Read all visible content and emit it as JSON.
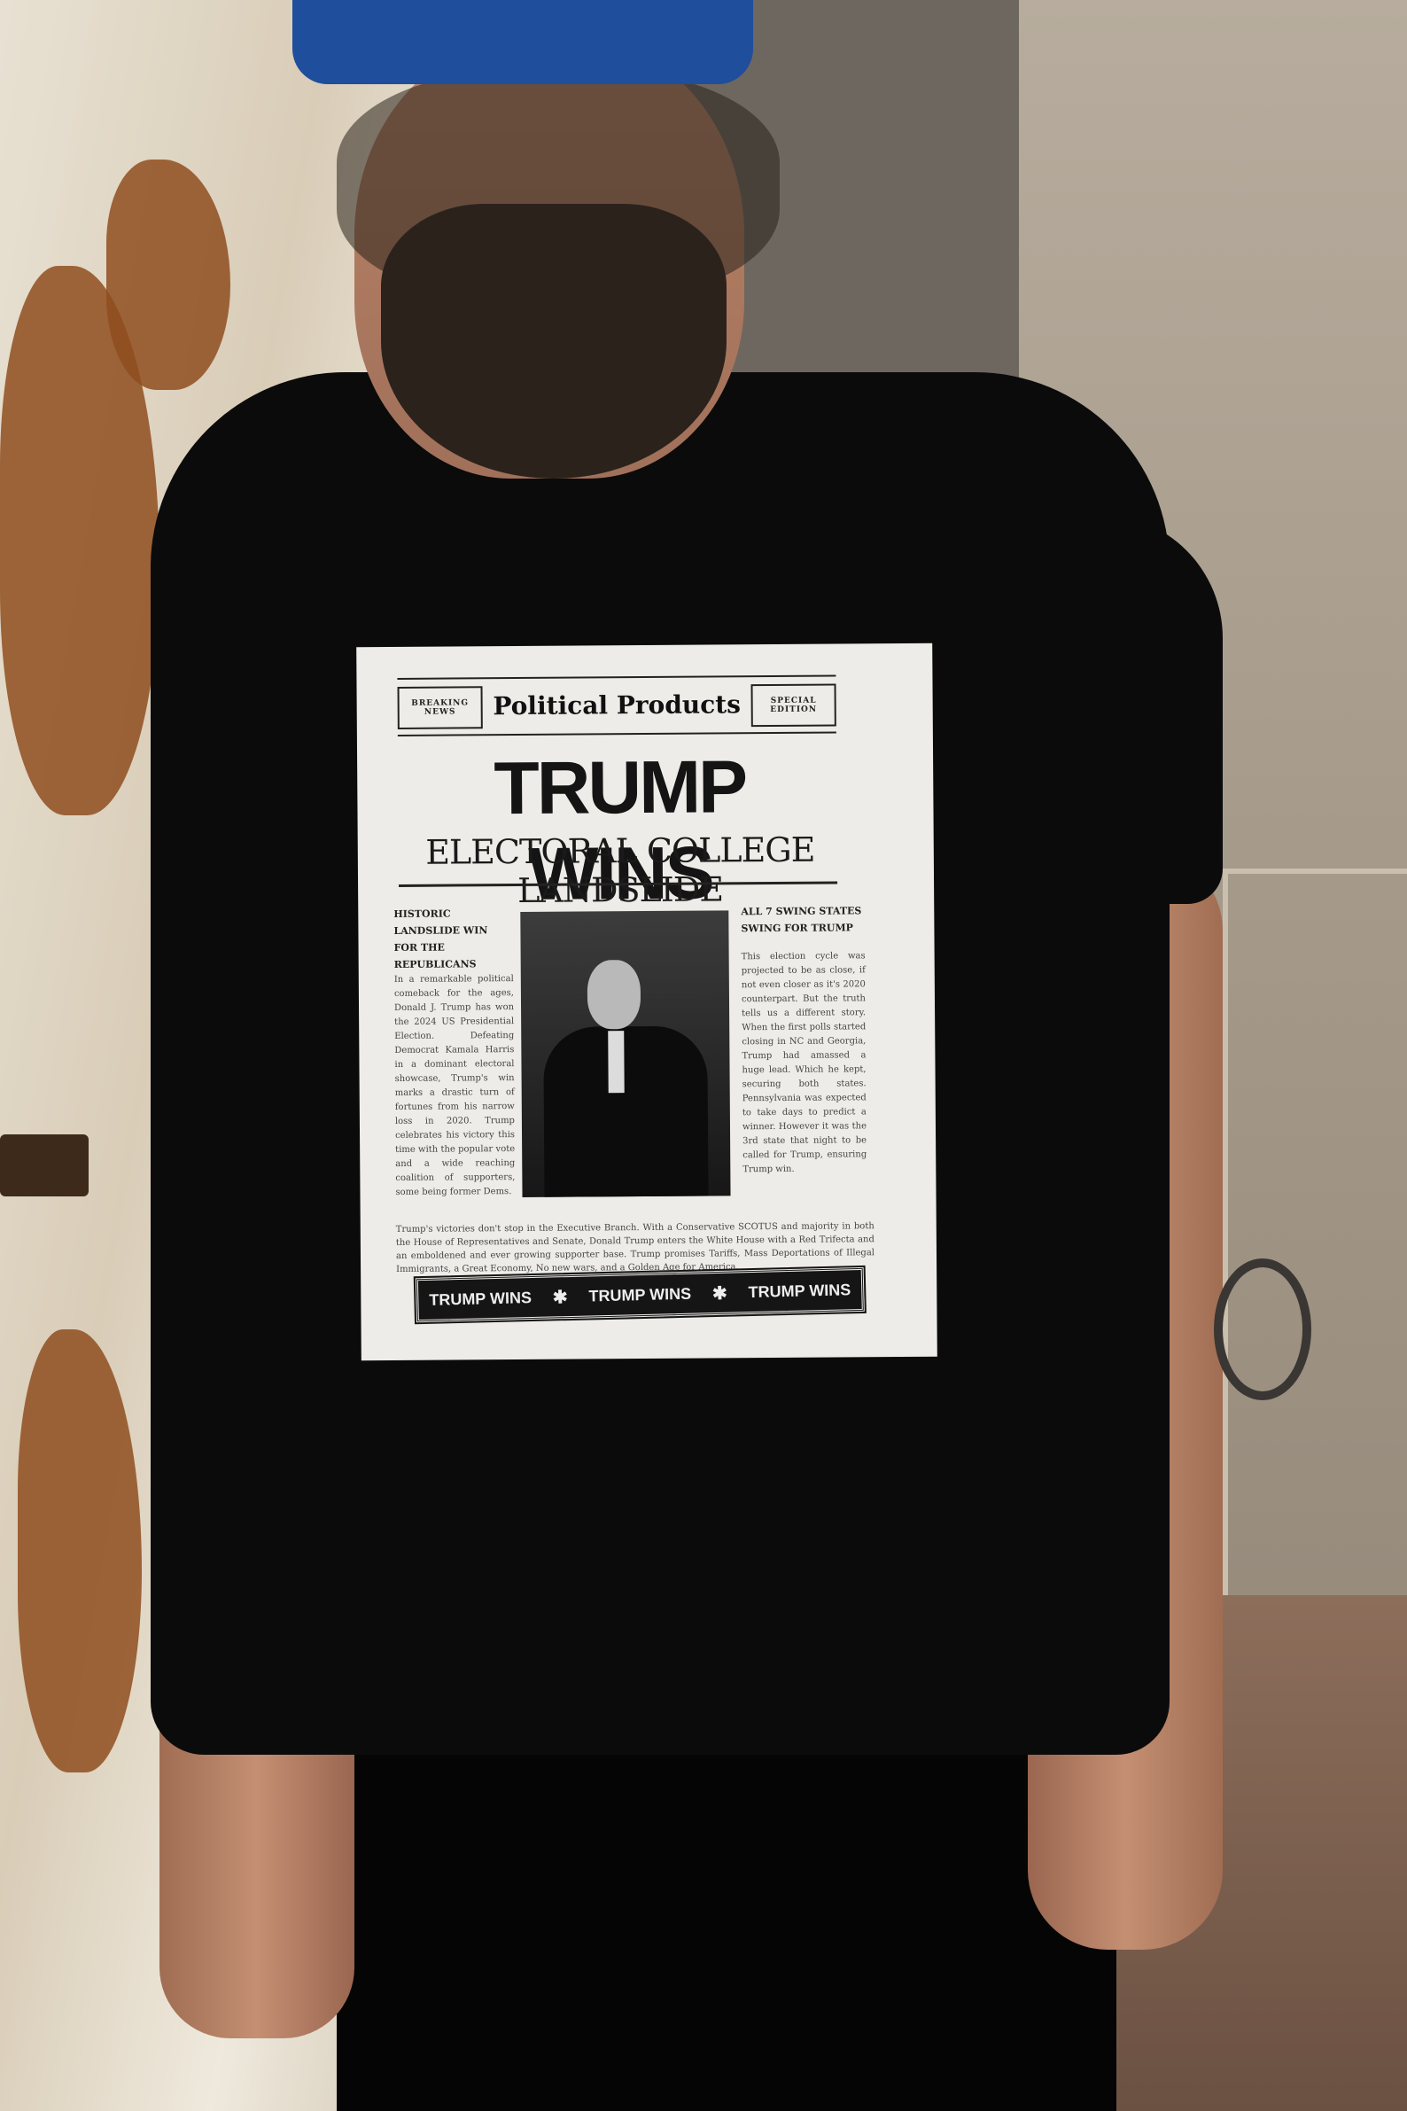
{
  "photo": {
    "description_elements": [
      "man",
      "blue-cap",
      "black-tshirt",
      "rusted-door",
      "tattoos"
    ]
  },
  "newspaper": {
    "badge_left": "BREAKING NEWS",
    "publication": "Political Products",
    "badge_right": "SPECIAL EDITION",
    "headline": "TRUMP WINS",
    "subheadline": "ELECTORAL COLLEGE LANDSLIDE",
    "left_column": {
      "heading": "HISTORIC LANDSLIDE WIN FOR THE REPUBLICANS",
      "body": "In a remarkable political comeback for the ages, Donald J. Trump has won the 2024 US Presidential Election. Defeating Democrat Kamala Harris in a dominant electoral showcase, Trump's win marks a drastic turn of fortunes from his narrow loss in 2020. Trump celebrates his victory this time with the popular vote and a wide reaching coalition of supporters, some being former Dems."
    },
    "right_column": {
      "heading": "ALL 7 SWING STATES SWING FOR TRUMP",
      "body": "This election cycle was projected to be as close, if not even closer as it's 2020 counterpart. But the truth tells us a different story. When the first polls started closing in NC and Georgia, Trump had amassed a huge lead. Which he kept, securing both states. Pennsylvania was expected to take days to predict a winner. However it was the 3rd state that night to be called for Trump, ensuring Trump win."
    },
    "footer": "Trump's victories don't stop in the Executive Branch. With a Conservative SCOTUS and majority in both the House of Representatives and Senate, Donald Trump enters the White House with a Red Trifecta and an emboldened and ever growing supporter base. Trump promises Tariffs, Mass Deportations of Illegal Immigrants, a Great Economy, No new wars, and a Golden Age for America.",
    "banner": [
      "TRUMP WINS",
      "TRUMP WINS",
      "TRUMP WINS"
    ],
    "banner_separator": "✱"
  }
}
